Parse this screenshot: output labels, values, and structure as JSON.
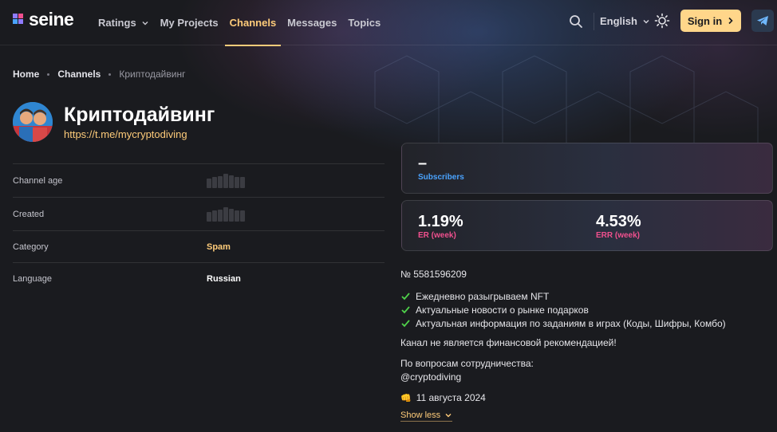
{
  "colors": {
    "accent": "#ffcc7a",
    "er_label": "#f0508e",
    "subscribers_label": "#4aa3ff",
    "check": "#4fd14a",
    "background": "#1a1b1f"
  },
  "header": {
    "logo_text": "seine",
    "nav": [
      {
        "label": "Ratings",
        "has_dropdown": true,
        "active": false
      },
      {
        "label": "My Projects",
        "has_dropdown": false,
        "active": false
      },
      {
        "label": "Channels",
        "has_dropdown": false,
        "active": true
      },
      {
        "label": "Messages",
        "has_dropdown": false,
        "active": false
      },
      {
        "label": "Topics",
        "has_dropdown": false,
        "active": false
      }
    ],
    "language": "English",
    "sign_in_label": "Sign in",
    "icons": [
      "search-icon",
      "sun-icon",
      "telegram-icon",
      "chevron-right-icon"
    ]
  },
  "breadcrumb": [
    "Home",
    "Channels",
    "Криптодайвинг"
  ],
  "channel": {
    "title": "Криптодайвинг",
    "link": "https://t.me/mycryptodiving"
  },
  "info": {
    "channel_age_label": "Channel age",
    "created_label": "Created",
    "category_label": "Category",
    "category_value": "Spam",
    "language_label": "Language",
    "language_value": "Russian"
  },
  "stats": {
    "subscribers_value": "–",
    "subscribers_label": "Subscribers",
    "er_value": "1.19%",
    "er_label": "ER (week)",
    "err_value": "4.53%",
    "err_label": "ERR (week)"
  },
  "description": {
    "id": "№ 5581596209",
    "checks": [
      "Ежедневно разыгрываем NFT",
      "Актуальные новости о рынке подарков",
      "Актуальная информация по заданиям в играх (Коды, Шифры, Комбо)"
    ],
    "disclaimer": "Канал не является финансовой рекомендацией!",
    "contact_label": "По вопросам сотрудничества:",
    "contact_handle": "@cryptodiving",
    "date_emoji": "👊",
    "date": "11 августа 2024",
    "show_less_label": "Show less"
  }
}
